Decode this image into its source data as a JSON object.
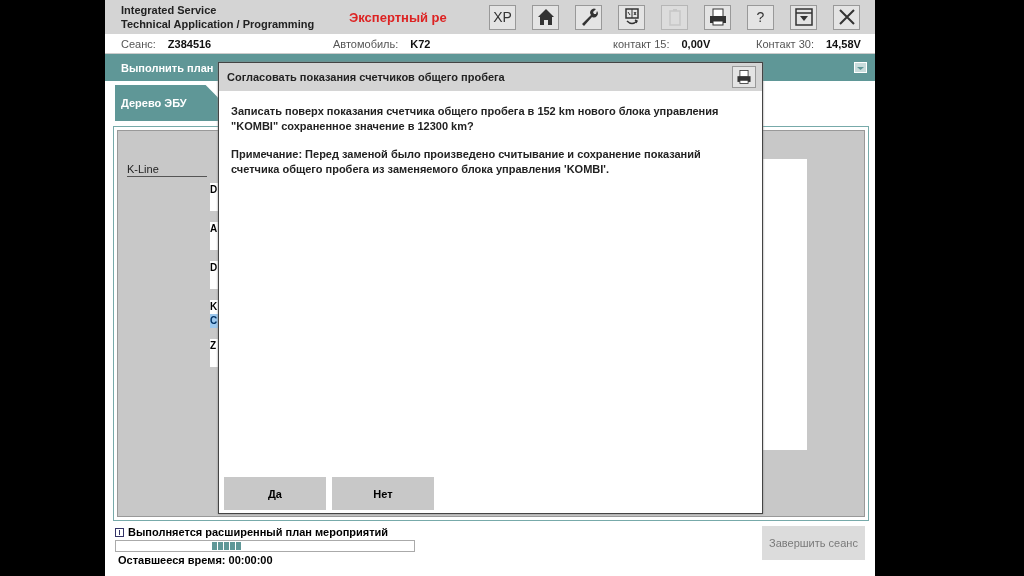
{
  "header": {
    "title_lines": [
      "Integrated Service",
      "Technical Application / Programming"
    ],
    "mode": "Экспертный ре",
    "toolbar": [
      {
        "kind": "text",
        "label": "XP",
        "disabled": false
      },
      {
        "kind": "home",
        "disabled": false
      },
      {
        "kind": "wrench",
        "disabled": false
      },
      {
        "kind": "swap",
        "disabled": false
      },
      {
        "kind": "battery",
        "disabled": true
      },
      {
        "kind": "printer",
        "disabled": false
      },
      {
        "kind": "text",
        "label": "?",
        "disabled": false
      },
      {
        "kind": "dropdown",
        "disabled": false
      },
      {
        "kind": "close",
        "disabled": false
      }
    ]
  },
  "info_bar": [
    {
      "label": "Сеанс:",
      "value": "Z384516"
    },
    {
      "label": "Автомобиль:",
      "value": "K72"
    },
    {
      "label": "контакт 15:",
      "value": "0,00V"
    },
    {
      "label": "Контакт 30:",
      "value": "14,58V"
    }
  ],
  "action_bar": {
    "title": "Выполнить план"
  },
  "tabs": [
    {
      "label": "Дерево ЭБУ",
      "selected": true
    }
  ],
  "tree": {
    "bus": "K-Line",
    "ecus": [
      {
        "label": "D"
      },
      {
        "label": "A"
      },
      {
        "label": "D"
      },
      {
        "label": "K",
        "sub": {
          "text": "C",
          "selected": true
        }
      },
      {
        "label": "Z"
      }
    ]
  },
  "dialog": {
    "title": "Согласовать показания счетчиков общего пробега",
    "paragraphs": [
      "Записать поверх показания счетчика общего пробега в 152 km нового блока управления \"KOMBI\" сохраненное значение в 12300 km?",
      "Примечание: Перед заменой было произведено считывание и сохранение показаний счетчика общего пробега из заменяемого блока управления 'KOMBI'."
    ],
    "buttons": [
      "Да",
      "Нет"
    ]
  },
  "status": {
    "message": "Выполняется расширенный план мероприятий",
    "remaining": "Оставшееся время: 00:00:00",
    "finish_button": {
      "label": "Завершить сеанс",
      "disabled": true
    }
  }
}
